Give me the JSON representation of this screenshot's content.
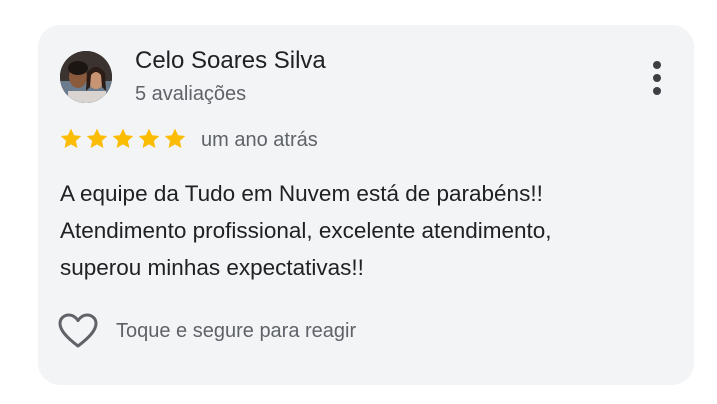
{
  "review": {
    "author_name": "Celo Soares Silva",
    "author_reviews": "5 avaliações",
    "rating": 5,
    "rating_max": 5,
    "time_ago": "um ano atrás",
    "text_lines": [
      "A equipe da Tudo em Nuvem está de parabéns!!",
      "Atendimento profissional, excelente atendimento,",
      "superou minhas expectativas!!"
    ],
    "react_label": "Toque e segure para reagir"
  },
  "icons": {
    "menu": "more-vert-icon",
    "star": "star-icon",
    "react": "heart-outline-icon"
  },
  "colors": {
    "card_background": "#f3f4f6",
    "star": "#fbbc04",
    "primary_text": "#202124",
    "secondary_text": "#5f6368"
  }
}
